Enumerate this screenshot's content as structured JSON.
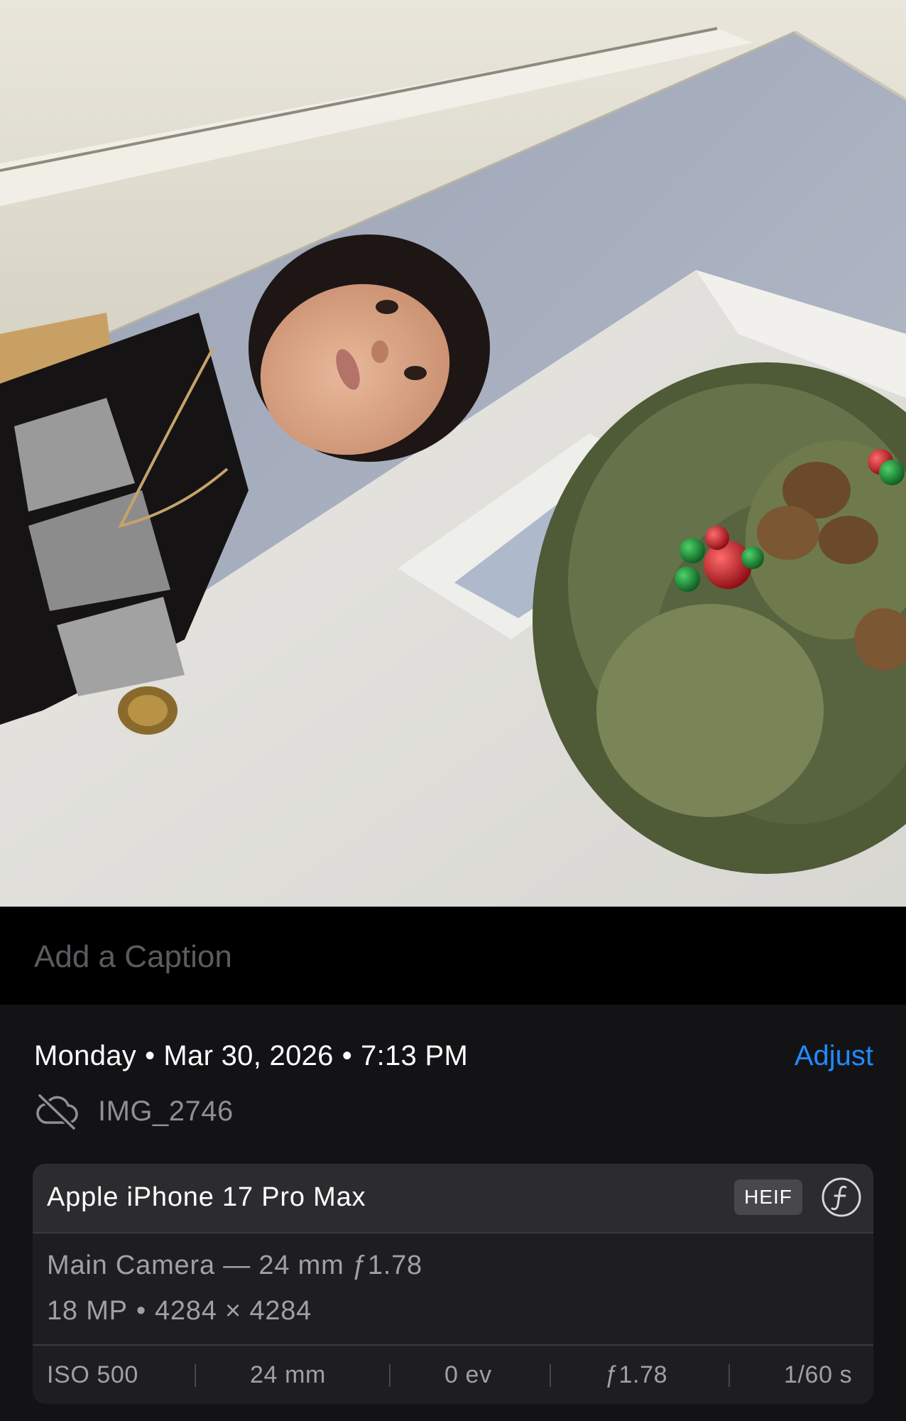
{
  "caption": {
    "placeholder": "Add a Caption"
  },
  "info": {
    "day": "Monday",
    "date": "Mar 30, 2026",
    "time": "7:13 PM",
    "separator": "•",
    "adjust_label": "Adjust",
    "cloud_icon": "cloud-slash-icon",
    "filename": "IMG_2746"
  },
  "device": {
    "name": "Apple iPhone 17 Pro Max",
    "format": "HEIF",
    "format_icon": "f-stop-icon",
    "lens": "Main Camera — 24 mm ƒ1.78",
    "megapixels": "18 MP",
    "dot": "•",
    "dimensions": "4284 × 4284",
    "exif": {
      "iso": "ISO 500",
      "focal": "24 mm",
      "ev": "0 ev",
      "aperture": "ƒ1.78",
      "shutter": "1/60 s"
    }
  },
  "colors": {
    "accent": "#1f8bff",
    "panel": "#131316",
    "card": "#1e1e21",
    "card_header": "#2c2c2f"
  }
}
